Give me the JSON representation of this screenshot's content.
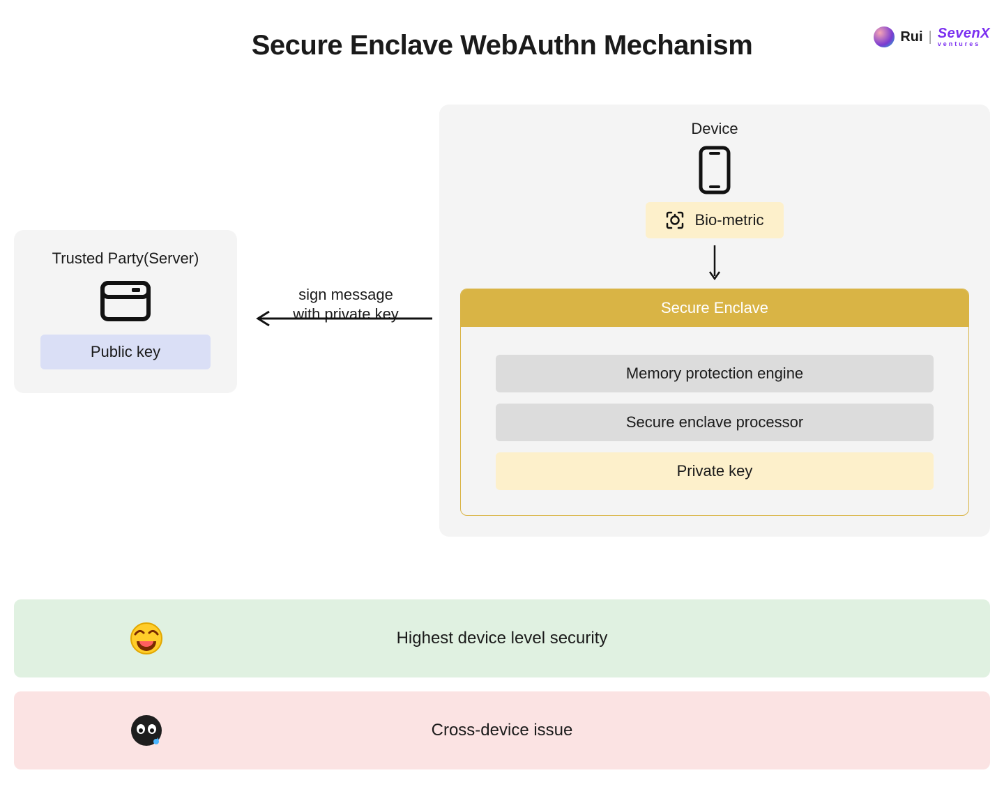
{
  "title": "Secure Enclave WebAuthn Mechanism",
  "brand": {
    "author": "Rui",
    "divider": "|",
    "logo_main": "SevenX",
    "logo_sub": "ventures"
  },
  "left": {
    "label": "Trusted Party(Server)",
    "pubkey": "Public key"
  },
  "arrow_label_line1": "sign message",
  "arrow_label_line2": "with private key",
  "right": {
    "device_label": "Device",
    "biometric_label": "Bio-metric",
    "enclave_title": "Secure Enclave",
    "rows": {
      "mem": "Memory protection engine",
      "proc": "Secure enclave processor",
      "priv": "Private key"
    }
  },
  "banners": {
    "pro": "Highest device level security",
    "con": "Cross-device issue"
  }
}
